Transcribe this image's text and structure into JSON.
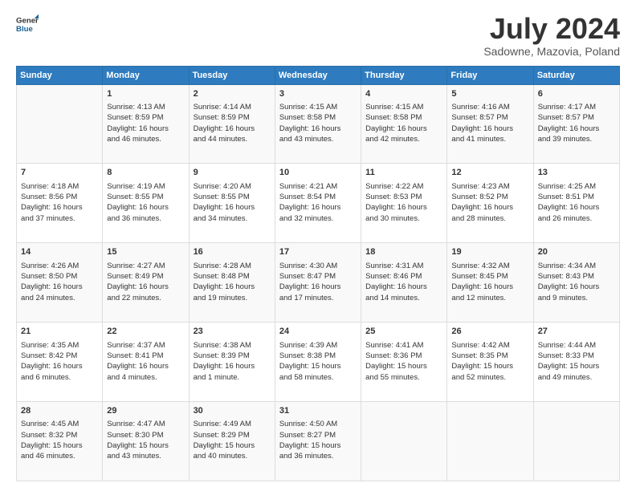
{
  "logo": {
    "line1": "General",
    "line2": "Blue"
  },
  "title": "July 2024",
  "subtitle": "Sadowne, Mazovia, Poland",
  "days_header": [
    "Sunday",
    "Monday",
    "Tuesday",
    "Wednesday",
    "Thursday",
    "Friday",
    "Saturday"
  ],
  "weeks": [
    [
      {
        "day": "",
        "lines": []
      },
      {
        "day": "1",
        "lines": [
          "Sunrise: 4:13 AM",
          "Sunset: 8:59 PM",
          "Daylight: 16 hours",
          "and 46 minutes."
        ]
      },
      {
        "day": "2",
        "lines": [
          "Sunrise: 4:14 AM",
          "Sunset: 8:59 PM",
          "Daylight: 16 hours",
          "and 44 minutes."
        ]
      },
      {
        "day": "3",
        "lines": [
          "Sunrise: 4:15 AM",
          "Sunset: 8:58 PM",
          "Daylight: 16 hours",
          "and 43 minutes."
        ]
      },
      {
        "day": "4",
        "lines": [
          "Sunrise: 4:15 AM",
          "Sunset: 8:58 PM",
          "Daylight: 16 hours",
          "and 42 minutes."
        ]
      },
      {
        "day": "5",
        "lines": [
          "Sunrise: 4:16 AM",
          "Sunset: 8:57 PM",
          "Daylight: 16 hours",
          "and 41 minutes."
        ]
      },
      {
        "day": "6",
        "lines": [
          "Sunrise: 4:17 AM",
          "Sunset: 8:57 PM",
          "Daylight: 16 hours",
          "and 39 minutes."
        ]
      }
    ],
    [
      {
        "day": "7",
        "lines": [
          "Sunrise: 4:18 AM",
          "Sunset: 8:56 PM",
          "Daylight: 16 hours",
          "and 37 minutes."
        ]
      },
      {
        "day": "8",
        "lines": [
          "Sunrise: 4:19 AM",
          "Sunset: 8:55 PM",
          "Daylight: 16 hours",
          "and 36 minutes."
        ]
      },
      {
        "day": "9",
        "lines": [
          "Sunrise: 4:20 AM",
          "Sunset: 8:55 PM",
          "Daylight: 16 hours",
          "and 34 minutes."
        ]
      },
      {
        "day": "10",
        "lines": [
          "Sunrise: 4:21 AM",
          "Sunset: 8:54 PM",
          "Daylight: 16 hours",
          "and 32 minutes."
        ]
      },
      {
        "day": "11",
        "lines": [
          "Sunrise: 4:22 AM",
          "Sunset: 8:53 PM",
          "Daylight: 16 hours",
          "and 30 minutes."
        ]
      },
      {
        "day": "12",
        "lines": [
          "Sunrise: 4:23 AM",
          "Sunset: 8:52 PM",
          "Daylight: 16 hours",
          "and 28 minutes."
        ]
      },
      {
        "day": "13",
        "lines": [
          "Sunrise: 4:25 AM",
          "Sunset: 8:51 PM",
          "Daylight: 16 hours",
          "and 26 minutes."
        ]
      }
    ],
    [
      {
        "day": "14",
        "lines": [
          "Sunrise: 4:26 AM",
          "Sunset: 8:50 PM",
          "Daylight: 16 hours",
          "and 24 minutes."
        ]
      },
      {
        "day": "15",
        "lines": [
          "Sunrise: 4:27 AM",
          "Sunset: 8:49 PM",
          "Daylight: 16 hours",
          "and 22 minutes."
        ]
      },
      {
        "day": "16",
        "lines": [
          "Sunrise: 4:28 AM",
          "Sunset: 8:48 PM",
          "Daylight: 16 hours",
          "and 19 minutes."
        ]
      },
      {
        "day": "17",
        "lines": [
          "Sunrise: 4:30 AM",
          "Sunset: 8:47 PM",
          "Daylight: 16 hours",
          "and 17 minutes."
        ]
      },
      {
        "day": "18",
        "lines": [
          "Sunrise: 4:31 AM",
          "Sunset: 8:46 PM",
          "Daylight: 16 hours",
          "and 14 minutes."
        ]
      },
      {
        "day": "19",
        "lines": [
          "Sunrise: 4:32 AM",
          "Sunset: 8:45 PM",
          "Daylight: 16 hours",
          "and 12 minutes."
        ]
      },
      {
        "day": "20",
        "lines": [
          "Sunrise: 4:34 AM",
          "Sunset: 8:43 PM",
          "Daylight: 16 hours",
          "and 9 minutes."
        ]
      }
    ],
    [
      {
        "day": "21",
        "lines": [
          "Sunrise: 4:35 AM",
          "Sunset: 8:42 PM",
          "Daylight: 16 hours",
          "and 6 minutes."
        ]
      },
      {
        "day": "22",
        "lines": [
          "Sunrise: 4:37 AM",
          "Sunset: 8:41 PM",
          "Daylight: 16 hours",
          "and 4 minutes."
        ]
      },
      {
        "day": "23",
        "lines": [
          "Sunrise: 4:38 AM",
          "Sunset: 8:39 PM",
          "Daylight: 16 hours",
          "and 1 minute."
        ]
      },
      {
        "day": "24",
        "lines": [
          "Sunrise: 4:39 AM",
          "Sunset: 8:38 PM",
          "Daylight: 15 hours",
          "and 58 minutes."
        ]
      },
      {
        "day": "25",
        "lines": [
          "Sunrise: 4:41 AM",
          "Sunset: 8:36 PM",
          "Daylight: 15 hours",
          "and 55 minutes."
        ]
      },
      {
        "day": "26",
        "lines": [
          "Sunrise: 4:42 AM",
          "Sunset: 8:35 PM",
          "Daylight: 15 hours",
          "and 52 minutes."
        ]
      },
      {
        "day": "27",
        "lines": [
          "Sunrise: 4:44 AM",
          "Sunset: 8:33 PM",
          "Daylight: 15 hours",
          "and 49 minutes."
        ]
      }
    ],
    [
      {
        "day": "28",
        "lines": [
          "Sunrise: 4:45 AM",
          "Sunset: 8:32 PM",
          "Daylight: 15 hours",
          "and 46 minutes."
        ]
      },
      {
        "day": "29",
        "lines": [
          "Sunrise: 4:47 AM",
          "Sunset: 8:30 PM",
          "Daylight: 15 hours",
          "and 43 minutes."
        ]
      },
      {
        "day": "30",
        "lines": [
          "Sunrise: 4:49 AM",
          "Sunset: 8:29 PM",
          "Daylight: 15 hours",
          "and 40 minutes."
        ]
      },
      {
        "day": "31",
        "lines": [
          "Sunrise: 4:50 AM",
          "Sunset: 8:27 PM",
          "Daylight: 15 hours",
          "and 36 minutes."
        ]
      },
      {
        "day": "",
        "lines": []
      },
      {
        "day": "",
        "lines": []
      },
      {
        "day": "",
        "lines": []
      }
    ]
  ]
}
